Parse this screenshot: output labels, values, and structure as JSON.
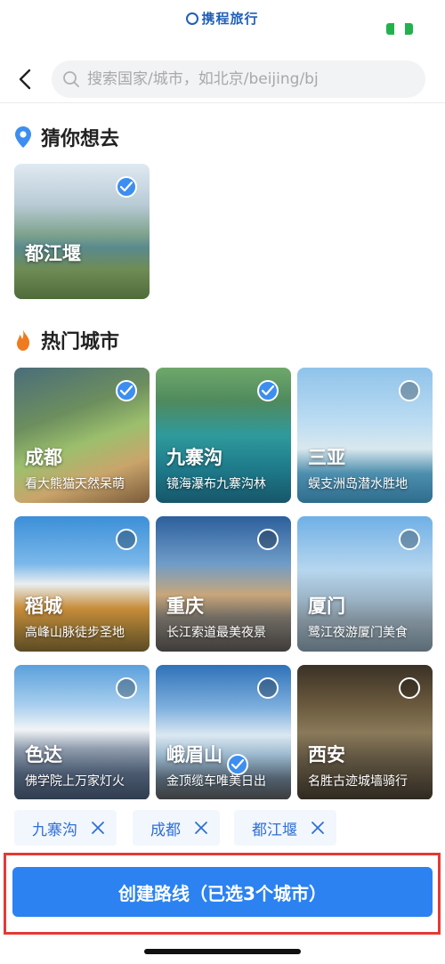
{
  "app": {
    "brand": "携程旅行"
  },
  "search": {
    "placeholder": "搜索国家/城市，如北京/beijing/bj"
  },
  "guess_section": {
    "title": "猜你想去",
    "items": [
      {
        "name": "都江堰",
        "selected": true
      }
    ]
  },
  "hot_section": {
    "title": "热门城市",
    "cities": [
      {
        "name": "成都",
        "desc": "看大熊猫天然呆萌",
        "selected": true
      },
      {
        "name": "九寨沟",
        "desc": "镜海瀑布九寨沟林",
        "selected": true
      },
      {
        "name": "三亚",
        "desc": "蜈支洲岛潜水胜地",
        "selected": false
      },
      {
        "name": "稻城",
        "desc": "高峰山脉徒步圣地",
        "selected": false
      },
      {
        "name": "重庆",
        "desc": "长江索道最美夜景",
        "selected": false
      },
      {
        "name": "厦门",
        "desc": "鹭江夜游厦门美食",
        "selected": false
      },
      {
        "name": "色达",
        "desc": "佛学院上万家灯火",
        "selected": false
      },
      {
        "name": "峨眉山",
        "desc": "金顶缆车唯美日出",
        "selected": false
      },
      {
        "name": "西安",
        "desc": "名胜古迹城墙骑行",
        "selected": false
      }
    ]
  },
  "selected_chips": [
    {
      "label": "九寨沟"
    },
    {
      "label": "成都"
    },
    {
      "label": "都江堰"
    }
  ],
  "cta": {
    "label": "创建路线（已选3个城市）"
  },
  "colors": {
    "accent": "#2b82f0",
    "chip_text": "#2e6fd8",
    "highlight_frame": "#e53935"
  }
}
